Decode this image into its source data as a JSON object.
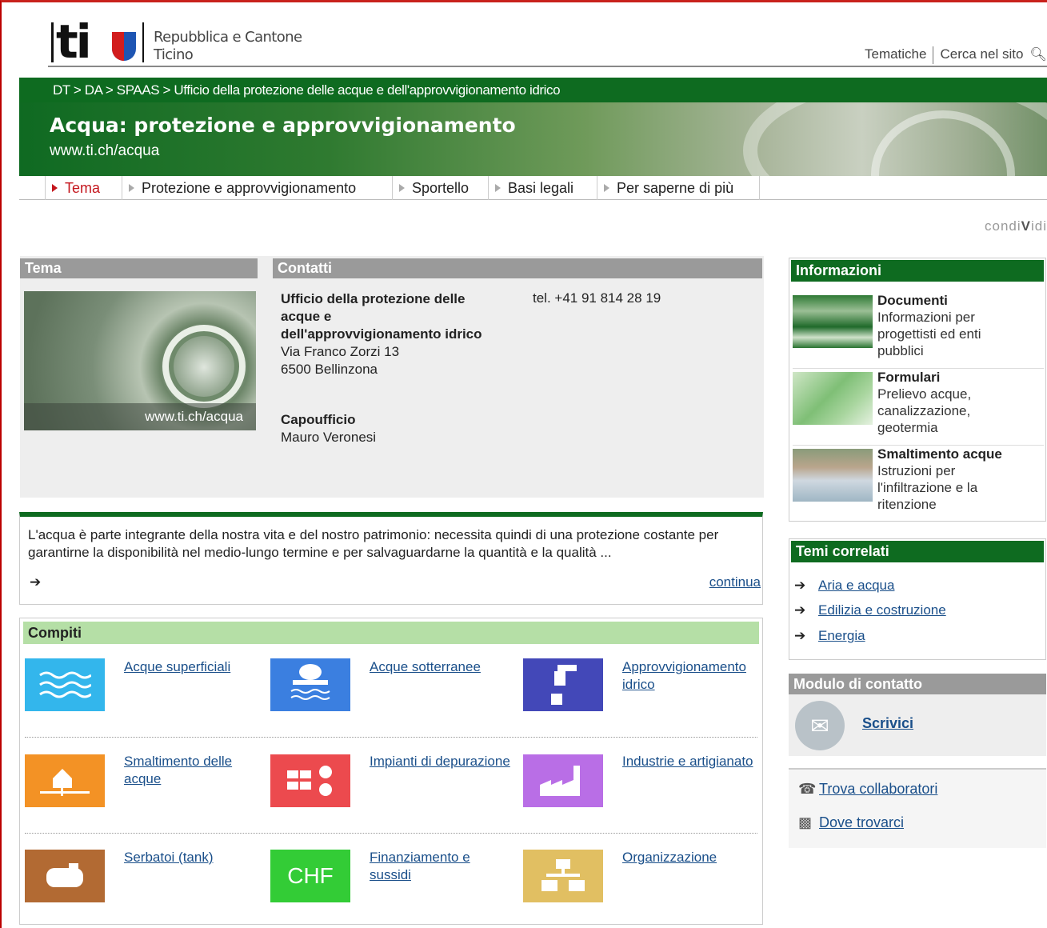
{
  "header": {
    "logo_text": "ti",
    "logo_subtitle_line1": "Repubblica e Cantone",
    "logo_subtitle_line2": "Ticino",
    "links": [
      "Tematiche",
      "Cerca nel sito"
    ]
  },
  "breadcrumb": "DT > DA > SPAAS > Ufficio della protezione delle acque e dell'approvvigionamento idrico",
  "banner": {
    "title": "Acqua: protezione e approvvigionamento",
    "url": "www.ti.ch/acqua"
  },
  "nav": {
    "items": [
      "Tema",
      "Protezione e approvvigionamento",
      "Sportello",
      "Basi legali",
      "Per saperne di più"
    ],
    "active": "Tema"
  },
  "condividi": {
    "prefix": "condi",
    "bold": "V",
    "suffix": "idi"
  },
  "tema": {
    "heading": "Tema",
    "image_caption": "www.ti.ch/acqua"
  },
  "contatti": {
    "heading": "Contatti",
    "office_line1": "Ufficio della protezione delle",
    "office_line2": "acque e",
    "office_line3": "dell'approvvigionamento idrico",
    "address1": "Via Franco Zorzi 13",
    "address2": "6500 Bellinzona",
    "phone": "tel. +41 91 814 28 19",
    "chief_label": "Capoufficio",
    "chief_name": "Mauro Veronesi"
  },
  "intro": {
    "text": "L'acqua è parte integrante della nostra vita e del nostro patrimonio: necessita quindi di una protezione costante per garantirne la disponibilità nel medio-lungo termine e per salvaguardarne la quantità e la qualità ...",
    "arrow": "➔",
    "more": "continua"
  },
  "compiti": {
    "heading": "Compiti",
    "items": [
      {
        "label": "Acque superficiali",
        "color": "#33b6ec",
        "icon": "waves-icon"
      },
      {
        "label": "Acque sotterranee",
        "color": "#3b7fe0",
        "icon": "groundwater-icon"
      },
      {
        "label": "Approvvigionamento idrico",
        "color": "#4348b8",
        "icon": "tap-icon"
      },
      {
        "label": "Smaltimento delle acque",
        "color": "#f39225",
        "icon": "house-drain-icon"
      },
      {
        "label": "Impianti di depurazione",
        "color": "#ec4a4e",
        "icon": "treatment-plant-icon"
      },
      {
        "label": "Industrie e artigianato",
        "color": "#b96ee6",
        "icon": "factory-icon"
      },
      {
        "label": "Serbatoi (tank)",
        "color": "#b26a33",
        "icon": "tank-icon"
      },
      {
        "label": "Finanziamento e sussidi",
        "color": "#33cc36",
        "icon": "chf-icon",
        "icon_text": "CHF"
      },
      {
        "label": "Organizzazione",
        "color": "#e1bf62",
        "icon": "org-chart-icon"
      }
    ]
  },
  "informazioni": {
    "heading": "Informazioni",
    "items": [
      {
        "title": "Documenti",
        "desc_lines": [
          "Informazioni per",
          "progettisti ed enti",
          "pubblici"
        ]
      },
      {
        "title": "Formulari",
        "desc_lines": [
          "Prelievo acque,",
          "canalizzazione,",
          "geotermia"
        ]
      },
      {
        "title": "Smaltimento acque",
        "desc_lines": [
          "Istruzioni per",
          "l'infiltrazione e la",
          "ritenzione"
        ]
      }
    ]
  },
  "temi_correlati": {
    "heading": "Temi correlati",
    "items": [
      "Aria e acqua",
      "Edilizia e costruzione",
      "Energia"
    ]
  },
  "modulo": {
    "heading": "Modulo di contatto",
    "link": "Scrivici"
  },
  "extra_links": [
    "Trova collaboratori",
    "Dove trovarci"
  ]
}
